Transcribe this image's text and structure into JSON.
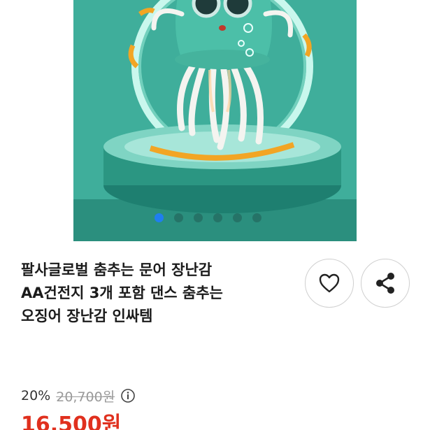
{
  "product": {
    "title_lines": [
      "팔사글로벌 춤추는 문어 장난감",
      "AA건전지 3개 포함 댄스 춤추는",
      "오징어 장난감 인싸템"
    ],
    "image_icon": "dancing-octopus-toy-photo",
    "carousel": {
      "total_slides": 6,
      "active_index": 0
    }
  },
  "actions": {
    "like_icon": "heart-icon",
    "share_icon": "share-icon"
  },
  "price": {
    "discount": "20%",
    "original": "20,700원",
    "info_icon": "info-icon",
    "sale": "16,500원"
  },
  "colors": {
    "sale_price": "#e0301e",
    "active_dot": "#1f7ef0",
    "background_teal": "#3aa592"
  }
}
